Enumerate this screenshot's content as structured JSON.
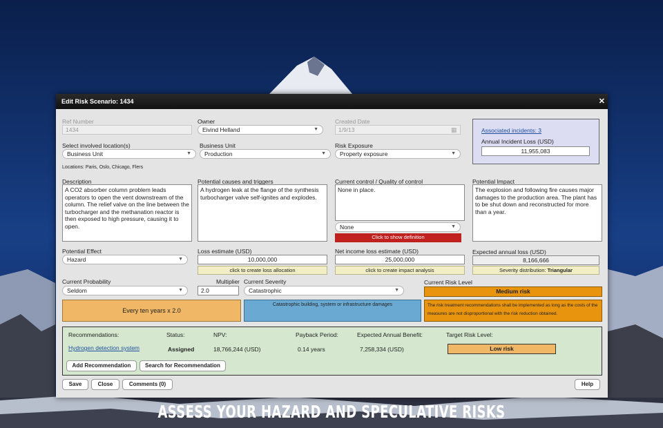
{
  "dialog": {
    "title": "Edit Risk Scenario: 1434"
  },
  "fields": {
    "ref_number": {
      "label": "Ref Number",
      "value": "1434"
    },
    "owner": {
      "label": "Owner",
      "value": "Eivind Helland"
    },
    "created_date": {
      "label": "Created Date",
      "value": "1/9/13"
    },
    "locations_select": {
      "label": "Select involved location(s)",
      "value": "Business Unit"
    },
    "locations_text": "Locations: Paris, Oslo, Chicago, Flers",
    "business_unit": {
      "label": "Business Unit",
      "value": "Production"
    },
    "risk_exposure": {
      "label": "Risk Exposure",
      "value": "Property exposure"
    }
  },
  "incidents": {
    "link": "Associated incidents: 3",
    "annual_label": "Annual Incident Loss (USD)",
    "annual_value": "11,955,083"
  },
  "descriptions": {
    "description": {
      "label": "Description",
      "value": "A CO2 absorber column problem leads operators to open the vent downstream of the column. The relief valve on the line between the turbocharger and the methanation reactor is then exposed to high pressure, causing it to open."
    },
    "causes": {
      "label": "Potential causes and triggers",
      "value": "A hydrogen leak at the flange of the synthesis turbocharger valve self-ignites and explodes."
    },
    "control": {
      "label": "Current control / Quality of control",
      "value": "None in place.",
      "quality": "None",
      "definition_button": "Click to show definition"
    },
    "impact": {
      "label": "Potential Impact",
      "value": "The explosion and following fire causes major damages to the production area. The plant has to be shut down and reconstructed for more than a year."
    }
  },
  "losses": {
    "potential_effect": {
      "label": "Potential Effect",
      "value": "Hazard"
    },
    "loss_estimate": {
      "label": "Loss estimate (USD)",
      "value": "10,000,000",
      "button": "click to create loss allocation"
    },
    "net_income": {
      "label": "Net income loss estimate (USD)",
      "value": "25,000,000",
      "button": "click to create impact analysis"
    },
    "expected_annual": {
      "label": "Expected annual loss (USD)",
      "value": "8,166,666",
      "distribution_label": "Severity distribution:",
      "distribution_value": "Triangular"
    }
  },
  "probability": {
    "label": "Current Probability",
    "value": "Seldom",
    "multiplier_label": "Multiplier",
    "multiplier_value": "2.0",
    "description": "Every ten years x 2.0"
  },
  "severity": {
    "label": "Current Severity",
    "value": "Catastrophic",
    "description": "Catastrophic building, system or infrastructure damages"
  },
  "risk_level": {
    "label": "Current Risk Level",
    "value": "Medium risk",
    "description": "The risk treatment recommendations shall be implemented as long as the costs of the measures are not disproportional with the risk reduction obtained."
  },
  "recommendations": {
    "headers": {
      "recommendations": "Recommendations:",
      "status": "Status:",
      "npv": "NPV:",
      "payback": "Payback Period:",
      "benefit": "Expected Annual Benefit:",
      "target": "Target Risk Level:"
    },
    "rows": [
      {
        "name": "Hydrogen detection system",
        "status": "Assigned",
        "npv": "18,766,244 (USD)",
        "payback": "0.14 years",
        "benefit": "7,258,334 (USD)",
        "target": "Low risk"
      }
    ],
    "add_button": "Add Recommendation",
    "search_button": "Search for Recommendation"
  },
  "footer": {
    "save": "Save",
    "close": "Close",
    "comments": "Comments (0)",
    "help": "Help"
  },
  "banner": "ASSESS YOUR HAZARD AND SPECULATIVE RISKS",
  "colors": {
    "probability_fill": "#f0b866",
    "severity_fill": "#6aa9d2",
    "risk_fill": "#e8940f",
    "target_fill": "#f0b866",
    "button_red": "#c0201e",
    "button_yellow": "#f1eec5",
    "recommend_bg": "#d5e8cf",
    "incident_bg": "#dcdcf2"
  }
}
